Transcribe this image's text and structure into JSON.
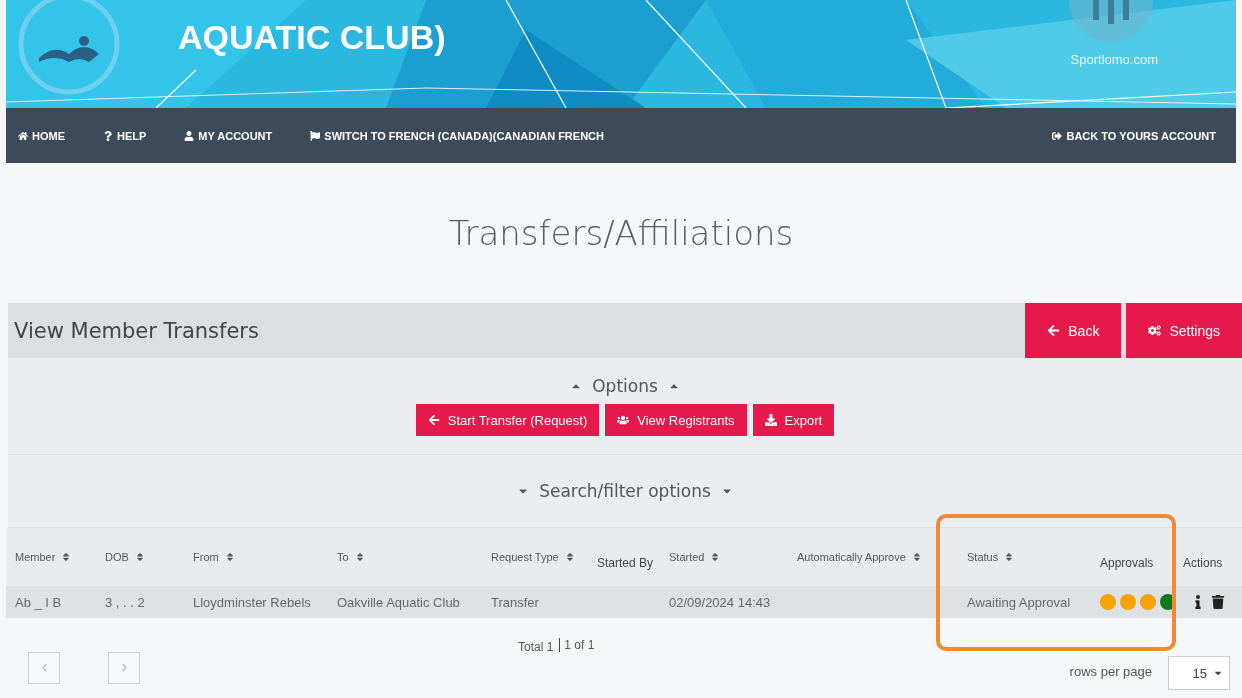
{
  "banner": {
    "title": "AQUATIC CLUB)",
    "brand": "Sportlomo.com"
  },
  "nav": {
    "left": [
      {
        "label": "HOME",
        "kind": "home"
      },
      {
        "label": "HELP",
        "kind": "help"
      },
      {
        "label": "MY ACCOUNT",
        "kind": "account"
      },
      {
        "label": "SWITCH TO FRENCH (CANADA)(CANADIAN FRENCH",
        "kind": "language"
      }
    ],
    "right": [
      {
        "label": "BACK TO YOURS ACCOUNT",
        "kind": "back"
      }
    ]
  },
  "page_title": "Transfers/Affiliations",
  "panel": {
    "title": "View Member Transfers",
    "buttons": [
      {
        "label": "Back",
        "kind": "back"
      },
      {
        "label": "Settings",
        "kind": "settings"
      }
    ]
  },
  "options": {
    "label": "Options",
    "expanded": true,
    "buttons": [
      {
        "label": "Start Transfer (Request)",
        "kind": "transfer"
      },
      {
        "label": "View Registrants",
        "kind": "users"
      },
      {
        "label": "Export",
        "kind": "export"
      }
    ]
  },
  "filter": {
    "label": "Search/filter options",
    "expanded": false
  },
  "table": {
    "columns": [
      {
        "label": "Member",
        "sortable": true
      },
      {
        "label": "DOB",
        "sortable": true
      },
      {
        "label": "From",
        "sortable": true
      },
      {
        "label": "To",
        "sortable": true
      },
      {
        "label": "Request Type",
        "sortable": true
      },
      {
        "label": "Started By",
        "sortable": false
      },
      {
        "label": "Started",
        "sortable": true
      },
      {
        "label": "Automatically Approve",
        "sortable": true
      },
      {
        "label": "Status",
        "sortable": true
      },
      {
        "label": "Approvals",
        "sortable": false
      },
      {
        "label": "Actions",
        "sortable": false
      }
    ],
    "rows": [
      {
        "cells": [
          "Ab _ I B",
          "3 , . . 2",
          "Lloydminster Rebels",
          "Oakville Aquatic Club",
          "Transfer",
          "",
          "02/09/2024 14:43",
          "",
          "Awaiting Approval"
        ],
        "approvals": [
          {
            "color": "#f5a300"
          },
          {
            "color": "#f5a300"
          },
          {
            "color": "#f5a300"
          },
          {
            "color": "#0a7a1e"
          }
        ]
      }
    ]
  },
  "footer": {
    "total": "Total 1",
    "pages": "1 of 1",
    "rows_label": "rows per page",
    "rows_value": "15"
  }
}
